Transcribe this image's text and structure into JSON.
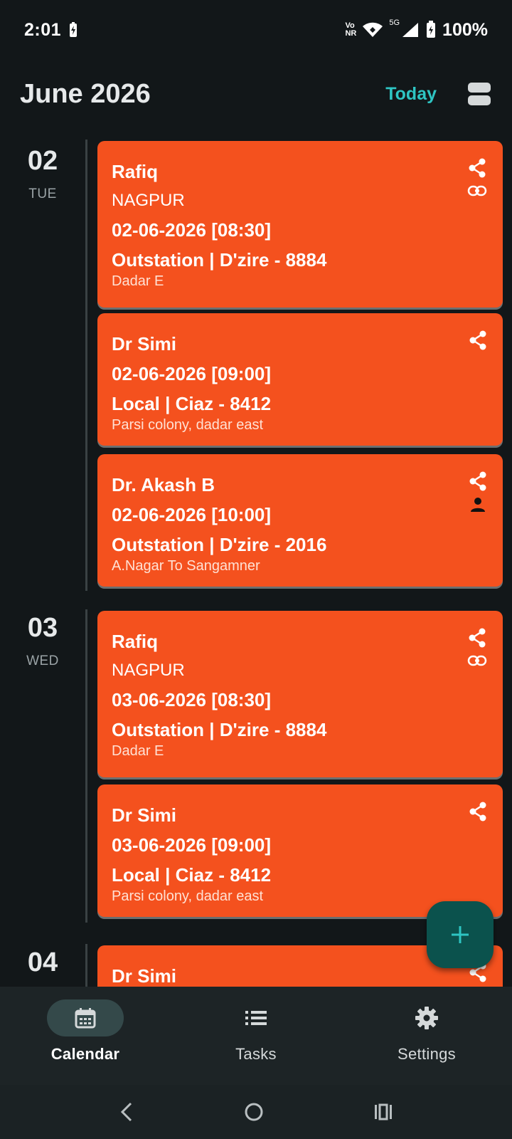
{
  "status_bar": {
    "time": "2:01",
    "network_line1": "Vo",
    "network_line2": "NR",
    "network_5g": "5G",
    "battery": "100%"
  },
  "header": {
    "month_title": "June 2026",
    "today_label": "Today"
  },
  "days": [
    {
      "num": "02",
      "name": "TUE",
      "events": [
        {
          "title": "Rafiq",
          "city": "NAGPUR",
          "date": "02-06-2026 [08:30]",
          "trip": "Outstation | D'zire - 8884",
          "place": "Dadar E",
          "icons": [
            "share-icon",
            "link-icon"
          ]
        },
        {
          "title": "Dr Simi",
          "city": "",
          "date": "02-06-2026 [09:00]",
          "trip": "Local | Ciaz - 8412",
          "place": "Parsi colony, dadar east",
          "icons": [
            "share-icon"
          ]
        },
        {
          "title": "Dr. Akash B",
          "city": "",
          "date": "02-06-2026 [10:00]",
          "trip": "Outstation | D'zire - 2016",
          "place": "A.Nagar To Sangamner",
          "icons": [
            "share-icon",
            "person-icon"
          ]
        }
      ]
    },
    {
      "num": "03",
      "name": "WED",
      "events": [
        {
          "title": "Rafiq",
          "city": "NAGPUR",
          "date": "03-06-2026 [08:30]",
          "trip": "Outstation | D'zire - 8884",
          "place": "Dadar E",
          "icons": [
            "share-icon",
            "link-icon"
          ]
        },
        {
          "title": "Dr Simi",
          "city": "",
          "date": "03-06-2026 [09:00]",
          "trip": "Local | Ciaz - 8412",
          "place": "Parsi colony, dadar east",
          "icons": [
            "share-icon"
          ]
        }
      ]
    },
    {
      "num": "04",
      "name": "",
      "events": [
        {
          "title": "Dr Simi",
          "city": "",
          "date": "",
          "trip": "",
          "place": "",
          "icons": [
            "share-icon"
          ]
        }
      ]
    }
  ],
  "bottom_nav": {
    "items": [
      {
        "label": "Calendar",
        "icon": "calendar-icon",
        "active": true
      },
      {
        "label": "Tasks",
        "icon": "list-icon",
        "active": false
      },
      {
        "label": "Settings",
        "icon": "gear-icon",
        "active": false
      }
    ]
  },
  "colors": {
    "background": "#121719",
    "event_card": "#f4511e",
    "accent": "#2ec5c3",
    "fab": "#0b524d"
  }
}
